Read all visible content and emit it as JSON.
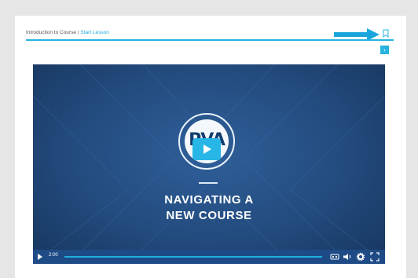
{
  "breadcrumb": {
    "course_label": "Introduction to Course /",
    "lesson_link": "Start Lesson"
  },
  "video": {
    "logo_text": "PVA",
    "title_line1": "NAVIGATING A",
    "title_line2": "NEW COURSE",
    "timestamp": "2:00"
  },
  "icons": {
    "bookmark": "bookmark-icon",
    "next": "chevron-right-icon",
    "play": "play-icon",
    "captions": "captions-icon",
    "volume": "volume-icon",
    "settings": "gear-icon",
    "fullscreen": "fullscreen-icon"
  },
  "colors": {
    "accent": "#26b3e0",
    "video_bg": "#234b7e",
    "controls_bg": "#1e4b86"
  }
}
